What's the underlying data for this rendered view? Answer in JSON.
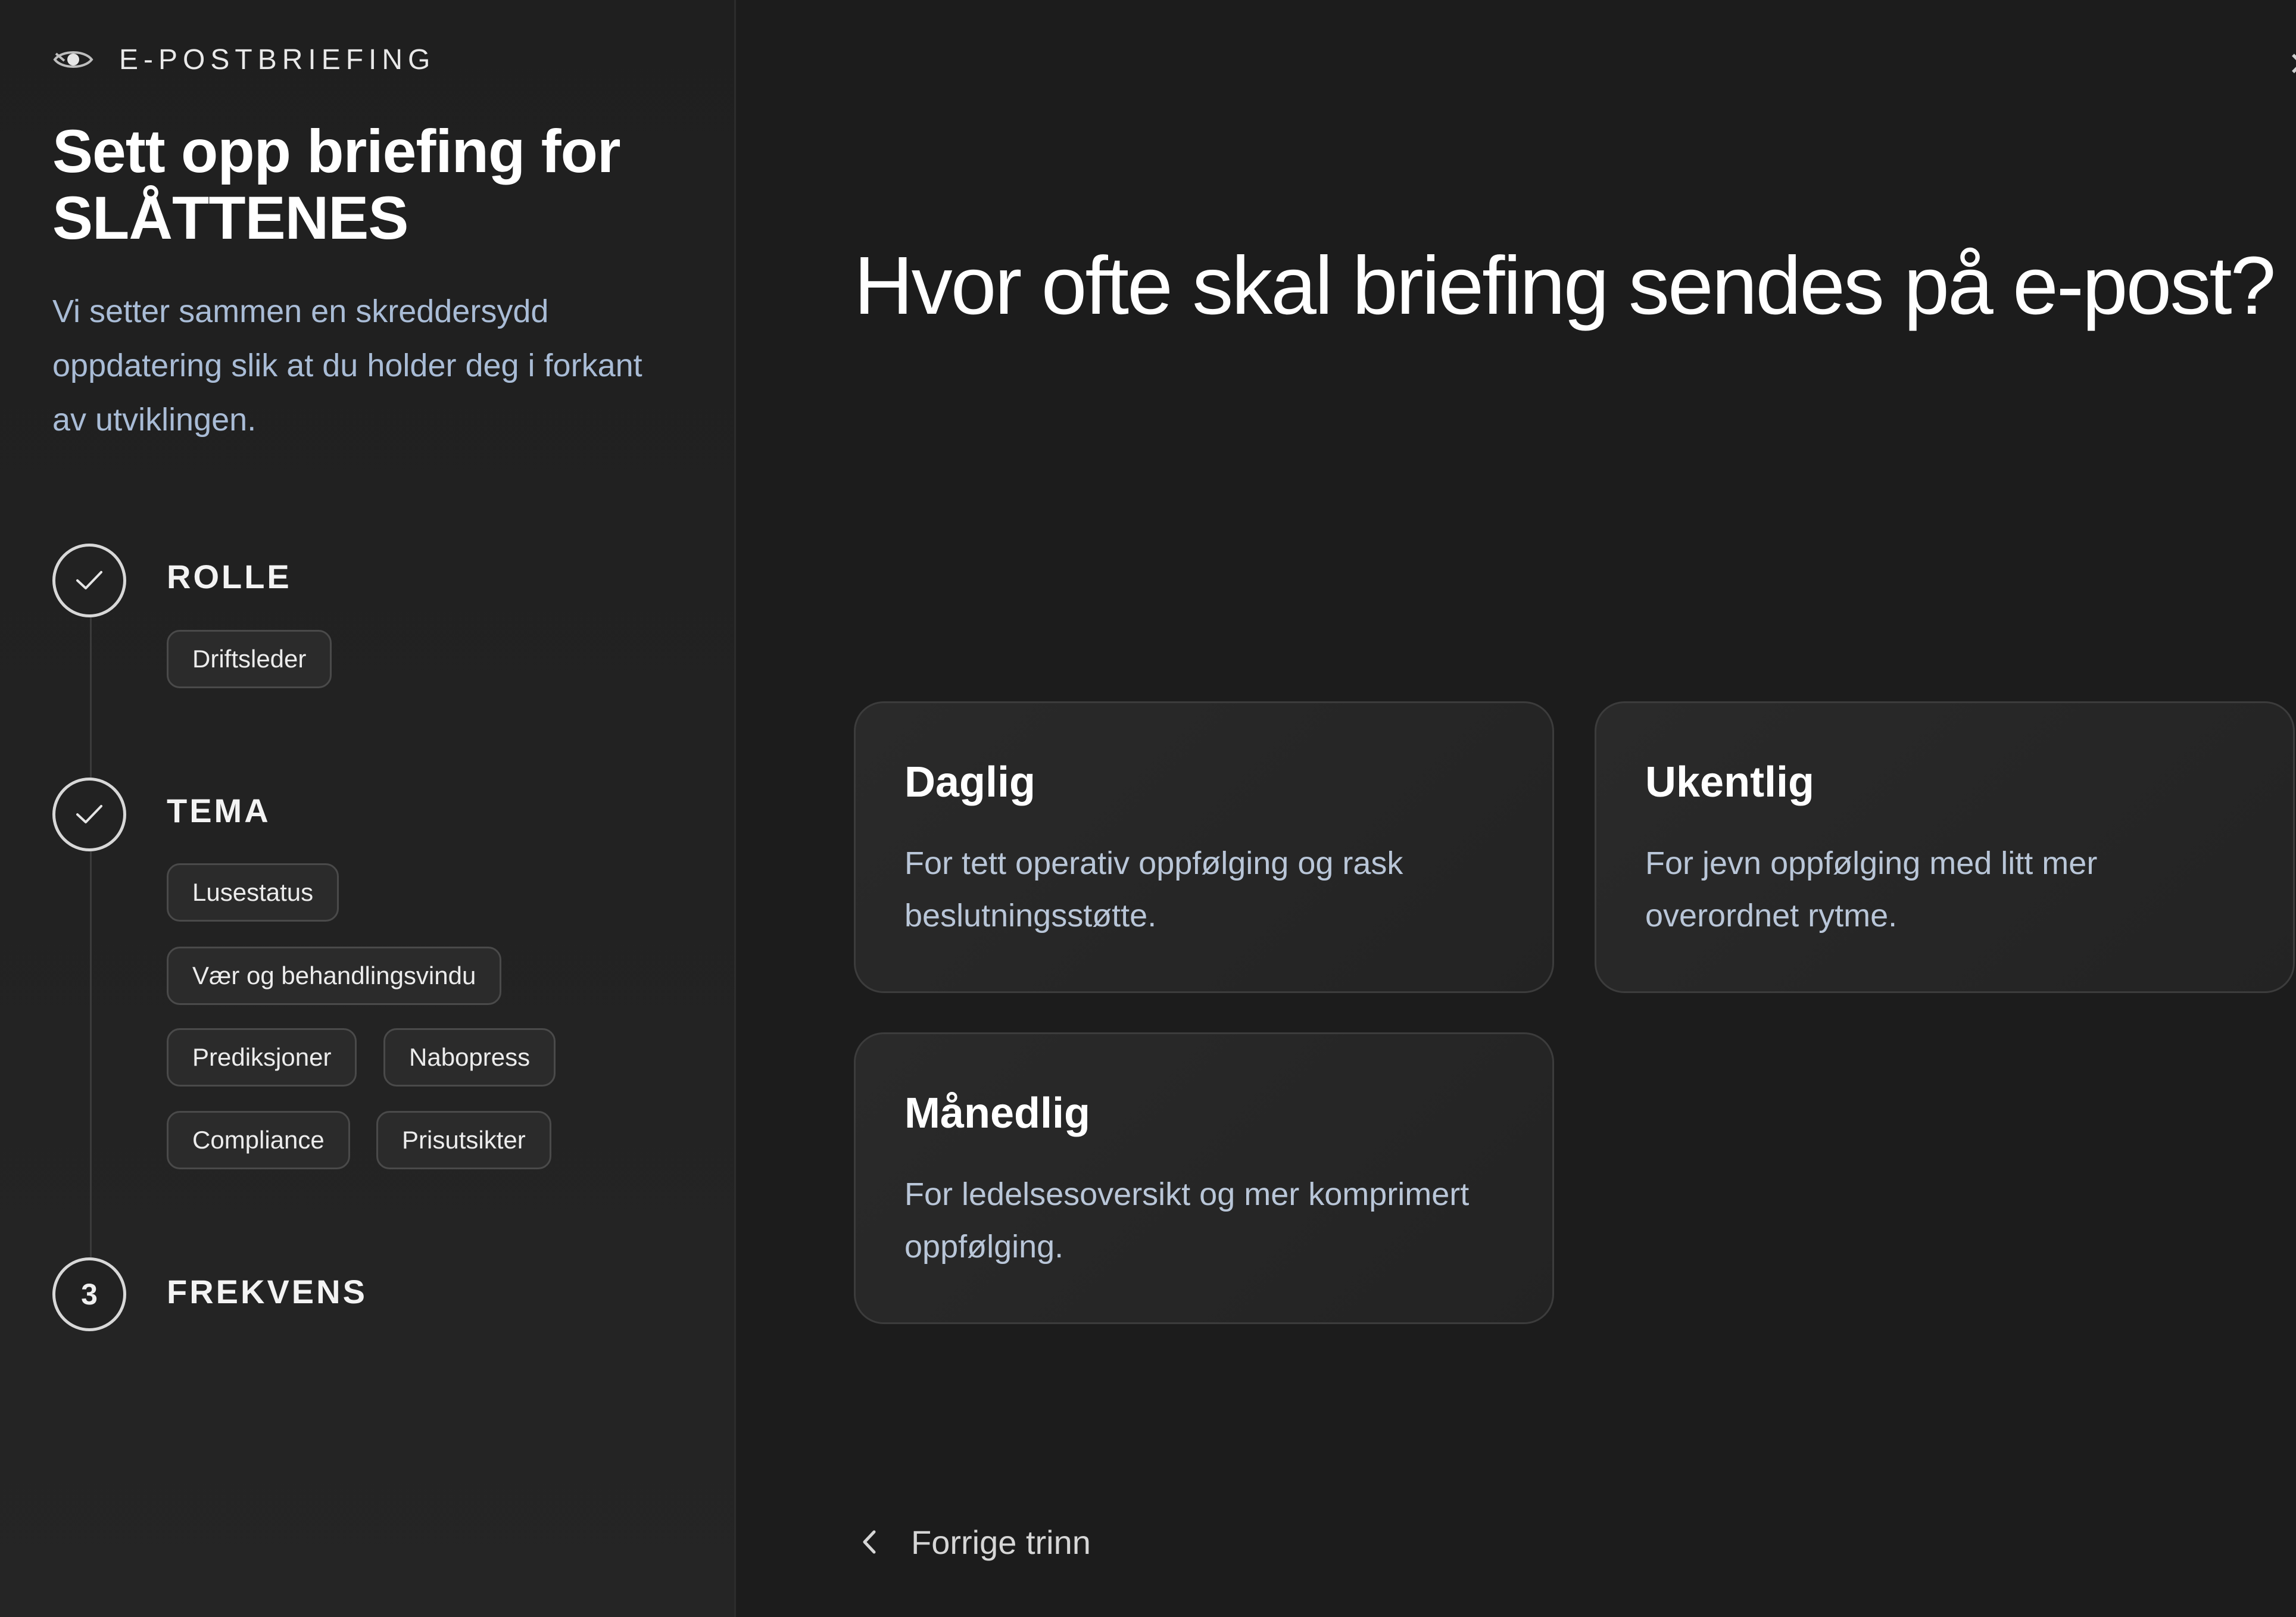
{
  "sidebar": {
    "brand": "E-POSTBRIEFING",
    "title": "Sett opp briefing for SLÅTTENES",
    "description": "Vi setter sammen en skreddersydd oppdatering slik at du holder deg i forkant av utviklingen.",
    "steps": [
      {
        "label": "ROLLE",
        "status": "completed",
        "icon": "check-icon",
        "chips": [
          "Driftsleder"
        ]
      },
      {
        "label": "TEMA",
        "status": "completed",
        "icon": "check-icon",
        "chips": [
          "Lusestatus",
          "Vær og behandlingsvindu",
          "Prediksjoner",
          "Nabopress",
          "Compliance",
          "Prisutsikter"
        ]
      },
      {
        "label": "FREKVENS",
        "status": "current",
        "number": "3"
      }
    ]
  },
  "main": {
    "question": "Hvor ofte skal briefing sendes på e-post?",
    "options": [
      {
        "title": "Daglig",
        "description": "For tett operativ oppfølging og rask beslutningsstøtte."
      },
      {
        "title": "Ukentlig",
        "description": "For jevn oppfølging med litt mer overordnet rytme."
      },
      {
        "title": "Månedlig",
        "description": "For ledelsesoversikt og mer komprimert oppfølging."
      }
    ],
    "back_label": "Forrige trinn"
  },
  "colors": {
    "background": "#1c1c1c",
    "sidebar": "#232323",
    "card": "#272727",
    "accent_text": "#a9bcd6"
  }
}
